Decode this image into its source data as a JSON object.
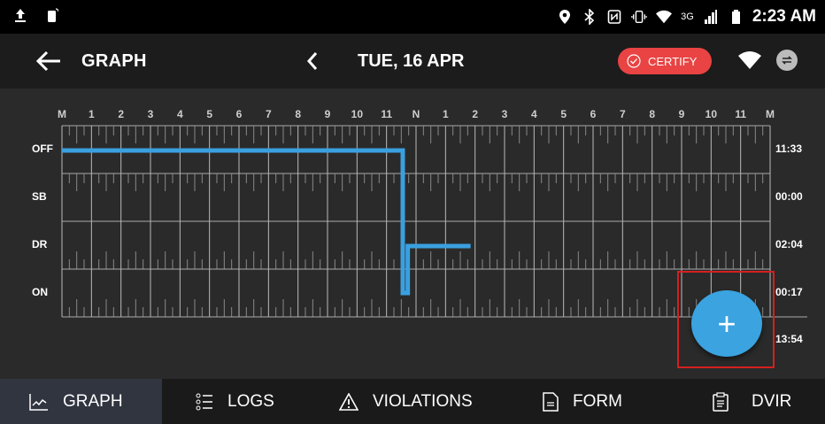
{
  "status_bar": {
    "time": "2:23 AM",
    "network": "3G",
    "icons": [
      "upload-icon",
      "phone-icon",
      "location-icon",
      "bluetooth-icon",
      "nfc-icon",
      "vibrate-icon",
      "wifi-icon",
      "signal-icon",
      "battery-icon"
    ]
  },
  "app_bar": {
    "title": "GRAPH",
    "date": "TUE, 16 APR",
    "certify_label": "CERTIFY"
  },
  "graph": {
    "hour_labels": [
      "M",
      "1",
      "2",
      "3",
      "4",
      "5",
      "6",
      "7",
      "8",
      "9",
      "10",
      "11",
      "N",
      "1",
      "2",
      "3",
      "4",
      "5",
      "6",
      "7",
      "8",
      "9",
      "10",
      "11",
      "M"
    ],
    "status_rows": [
      {
        "label": "OFF",
        "total": "11:33"
      },
      {
        "label": "SB",
        "total": "00:00"
      },
      {
        "label": "DR",
        "total": "02:04"
      },
      {
        "label": "ON",
        "total": "00:17"
      }
    ],
    "grand_total": "13:54",
    "events": [
      {
        "status": "OFF",
        "start_hour": 0,
        "end_hour": 11.55
      },
      {
        "status": "ON",
        "start_hour": 11.55,
        "end_hour": 11.72
      },
      {
        "status": "DR",
        "start_hour": 11.72,
        "end_hour": 13.85
      }
    ],
    "line_color": "#3aa0e0"
  },
  "fab": {
    "label": "+"
  },
  "bottom_nav": [
    {
      "label": "GRAPH",
      "icon": "chart-icon",
      "active": true
    },
    {
      "label": "LOGS",
      "icon": "list-icon",
      "active": false
    },
    {
      "label": "VIOLATIONS",
      "icon": "warning-icon",
      "active": false
    },
    {
      "label": "FORM",
      "icon": "document-icon",
      "active": false
    },
    {
      "label": "DVIR",
      "icon": "clipboard-icon",
      "active": false
    }
  ],
  "colors": {
    "accent": "#3aa3e0",
    "certify": "#e94343",
    "highlight": "#d42020"
  }
}
